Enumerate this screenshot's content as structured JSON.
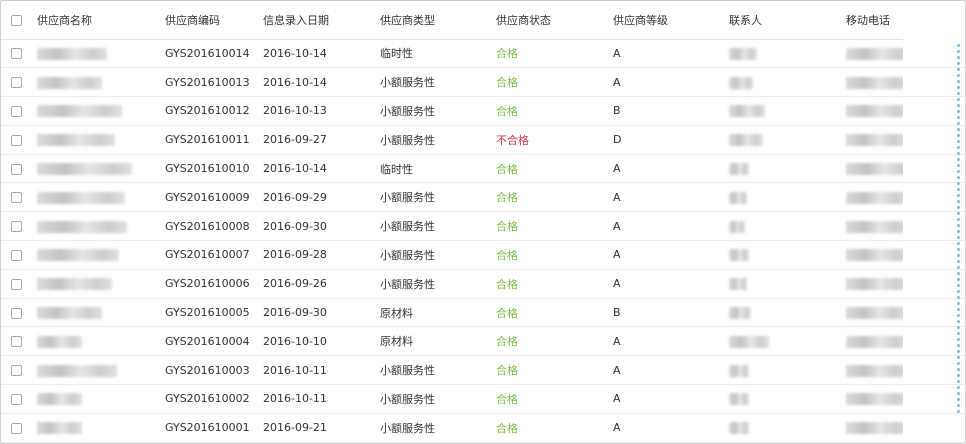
{
  "columns": [
    "供应商名称",
    "供应商编码",
    "信息录入日期",
    "供应商类型",
    "供应商状态",
    "供应商等级",
    "联系人",
    "移动电话"
  ],
  "colors": {
    "ok": "#7cc04a",
    "bad": "#d0364b",
    "scroll": "#7fbce8"
  },
  "rows": [
    {
      "code": "GYS201610014",
      "date": "2016-10-14",
      "type": "临时性",
      "status": "合格",
      "status_kind": "ok",
      "grade": "A"
    },
    {
      "code": "GYS201610013",
      "date": "2016-10-14",
      "type": "小额服务性",
      "status": "合格",
      "status_kind": "ok",
      "grade": "A"
    },
    {
      "code": "GYS201610012",
      "date": "2016-10-13",
      "type": "小额服务性",
      "status": "合格",
      "status_kind": "ok",
      "grade": "B"
    },
    {
      "code": "GYS201610011",
      "date": "2016-09-27",
      "type": "小额服务性",
      "status": "不合格",
      "status_kind": "bad",
      "grade": "D"
    },
    {
      "code": "GYS201610010",
      "date": "2016-10-14",
      "type": "临时性",
      "status": "合格",
      "status_kind": "ok",
      "grade": "A"
    },
    {
      "code": "GYS201610009",
      "date": "2016-09-29",
      "type": "小额服务性",
      "status": "合格",
      "status_kind": "ok",
      "grade": "A"
    },
    {
      "code": "GYS201610008",
      "date": "2016-09-30",
      "type": "小额服务性",
      "status": "合格",
      "status_kind": "ok",
      "grade": "A"
    },
    {
      "code": "GYS201610007",
      "date": "2016-09-28",
      "type": "小额服务性",
      "status": "合格",
      "status_kind": "ok",
      "grade": "A"
    },
    {
      "code": "GYS201610006",
      "date": "2016-09-26",
      "type": "小额服务性",
      "status": "合格",
      "status_kind": "ok",
      "grade": "A"
    },
    {
      "code": "GYS201610005",
      "date": "2016-09-30",
      "type": "原材料",
      "status": "合格",
      "status_kind": "ok",
      "grade": "B"
    },
    {
      "code": "GYS201610004",
      "date": "2016-10-10",
      "type": "原材料",
      "status": "合格",
      "status_kind": "ok",
      "grade": "A"
    },
    {
      "code": "GYS201610003",
      "date": "2016-10-11",
      "type": "小额服务性",
      "status": "合格",
      "status_kind": "ok",
      "grade": "A"
    },
    {
      "code": "GYS201610002",
      "date": "2016-10-11",
      "type": "小额服务性",
      "status": "合格",
      "status_kind": "ok",
      "grade": "A"
    },
    {
      "code": "GYS201610001",
      "date": "2016-09-21",
      "type": "小额服务性",
      "status": "合格",
      "status_kind": "ok",
      "grade": "A"
    }
  ]
}
